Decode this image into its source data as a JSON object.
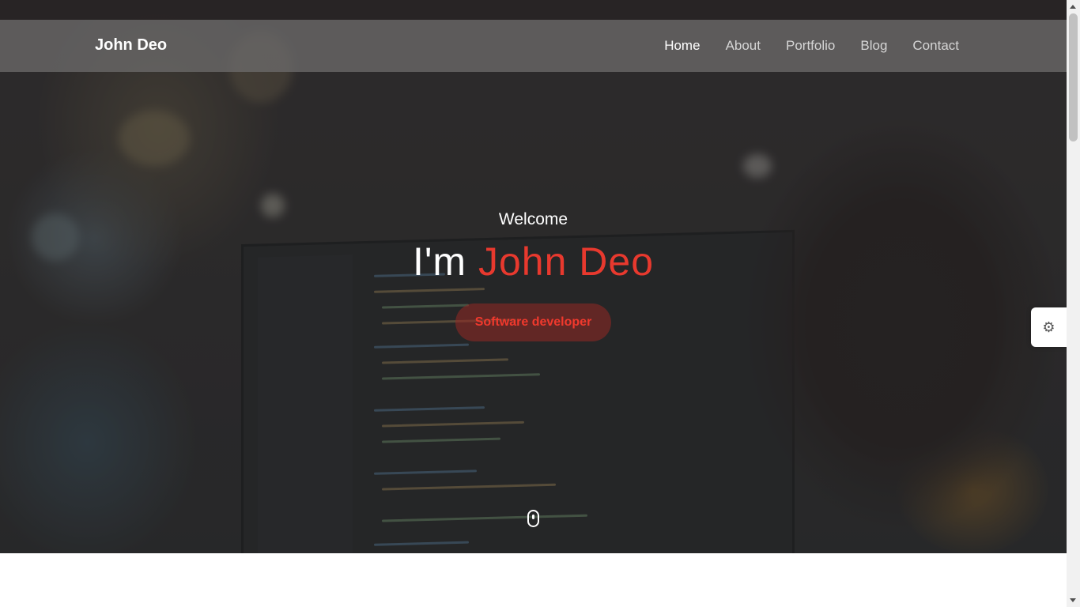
{
  "header": {
    "brand": "John Deo",
    "nav": [
      {
        "label": "Home",
        "active": true
      },
      {
        "label": "About",
        "active": false
      },
      {
        "label": "Portfolio",
        "active": false
      },
      {
        "label": "Blog",
        "active": false
      },
      {
        "label": "Contact",
        "active": false
      }
    ]
  },
  "hero": {
    "welcome": "Welcome",
    "headline_prefix": "I'm",
    "headline_name": "John Deo",
    "role_button": "Software developer",
    "scroll_icon": "mouse-scroll-icon"
  },
  "settings": {
    "icon": "gear-icon",
    "glyph": "⚙"
  },
  "colors": {
    "accent": "#e8392e",
    "navbar_bg": "#6e6c6c",
    "text_light": "#ffffff"
  }
}
